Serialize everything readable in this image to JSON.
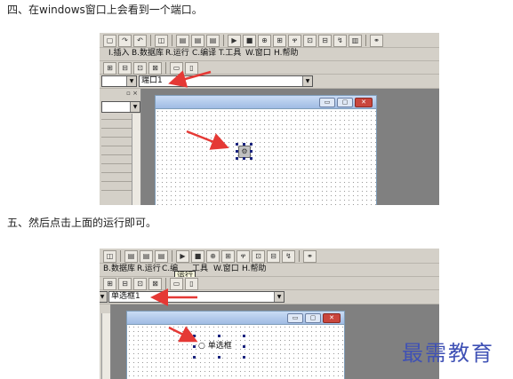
{
  "steps": [
    {
      "text": "四、在windows窗口上会看到一个端口。"
    },
    {
      "text": "五、然后点击上面的运行即可。"
    }
  ],
  "screenshot_a": {
    "menu": [
      "I.插入",
      "B.数据库",
      "R.运行",
      "C.编译",
      "T.工具",
      "W.窗口",
      "H.帮助"
    ],
    "combo_value": "端口1",
    "control_icon": "port-icon"
  },
  "screenshot_b": {
    "menu": [
      "B.数据库",
      "R.运行",
      "C.编",
      "工具",
      "W.窗口",
      "H.帮助"
    ],
    "tooltip": "运行",
    "combo_value": "单选框1",
    "radio_label": "单选框"
  },
  "icons": {
    "toolbar_a": [
      "copy-icon",
      "redo-icon",
      "undo-icon",
      "preview-icon",
      "grid-icon",
      "grid2-icon",
      "grid3-icon",
      "run-icon",
      "stop-icon",
      "tool1-icon",
      "tool2-icon",
      "tool3-icon",
      "tool4-icon",
      "tool5-icon",
      "tool6-icon",
      "tool7-icon",
      "binoculars-icon"
    ],
    "toolbar_b": [
      "preview-icon",
      "grid-icon",
      "grid2-icon",
      "grid3-icon",
      "run-icon",
      "stop-icon",
      "tool1-icon",
      "tool2-icon",
      "tool3-icon",
      "tool4-icon",
      "tool5-icon",
      "tool6-icon",
      "binoculars-icon"
    ]
  },
  "watermark": "最需教育",
  "colors": {
    "arrow": "#e53935",
    "watermark": "#3f51b5",
    "close_button": "#c9463d"
  }
}
